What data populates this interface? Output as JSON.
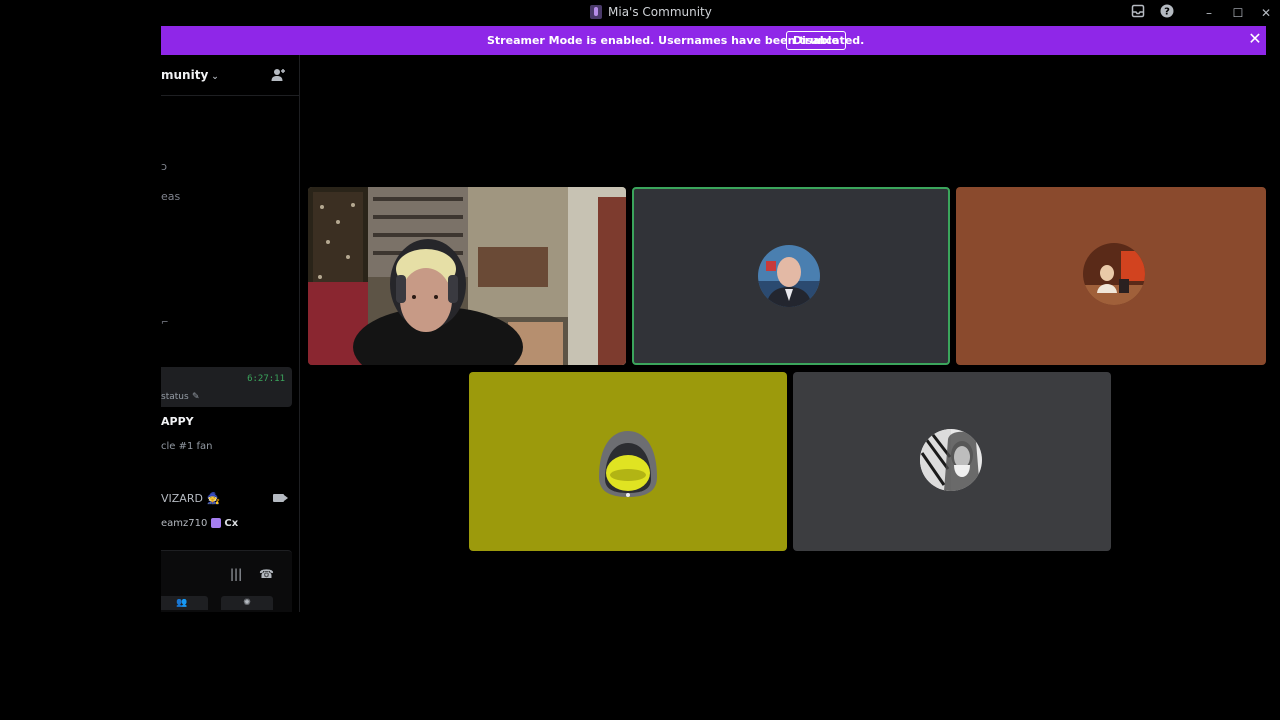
{
  "window": {
    "title": "Mia's Community",
    "controls": {
      "inbox_icon": "inbox-icon",
      "help_icon": "help-icon",
      "minimize": "–",
      "maximize": "☐",
      "close": "✕"
    }
  },
  "banner": {
    "message": "Streamer Mode is enabled. Usernames have been truncated.",
    "disable_label": "Disable",
    "close_glyph": "✕",
    "color": "#8f27e8"
  },
  "sidebar": {
    "server_name": "munity",
    "chevron": "⌄",
    "channel_fragments": [
      "ɔ",
      "eas",
      "⌐"
    ],
    "voice_status": {
      "timer": "6:27:11",
      "set_status": "status",
      "pencil": "✎"
    },
    "members": [
      {
        "name": "APPY",
        "sub": "cle #1 fan"
      },
      {
        "name": "VIZARD 🧙"
      },
      {
        "name": "eamz710",
        "tag": "Cx"
      }
    ],
    "voice_panel": {
      "noise_glyph": "|||",
      "hangup_glyph": "☎",
      "btn1_glyph": "👥",
      "btn2_glyph": "✺"
    }
  },
  "call": {
    "tiles": [
      {
        "kind": "camera",
        "speaking": false
      },
      {
        "kind": "avatar",
        "speaking": true,
        "bg": "#313338"
      },
      {
        "kind": "avatar",
        "speaking": false,
        "bg": "#8a4a2d"
      },
      {
        "kind": "avatar",
        "speaking": false,
        "bg": "#9c9a0c"
      },
      {
        "kind": "avatar",
        "speaking": false,
        "bg": "#3c3d40"
      }
    ],
    "speaking_color": "#3ba55c"
  }
}
